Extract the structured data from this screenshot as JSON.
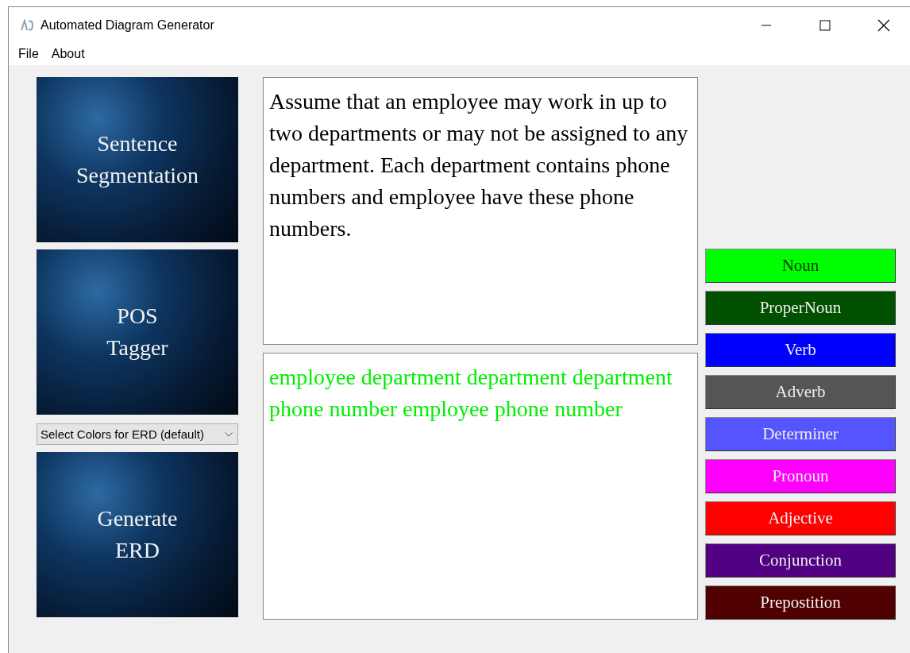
{
  "window": {
    "title": "Automated Diagram Generator"
  },
  "menu": [
    "File",
    "About"
  ],
  "tiles_top": [
    {
      "label": "Sentence Segmentation"
    },
    {
      "label": "POS Tagger"
    }
  ],
  "color_select": {
    "value": "Select Colors for ERD (default)"
  },
  "tiles_bottom": [
    {
      "label": "Generate ERD"
    }
  ],
  "input_text": "Assume that an employee may work in up to two departments or may not be assigned to any department. Each department contains phone numbers and employee have these phone numbers.",
  "output_text": "employee department department department phone number employee phone number",
  "legend": [
    {
      "label": "Noun",
      "color": "#00ff00"
    },
    {
      "label": "ProperNoun",
      "color": "#005000"
    },
    {
      "label": "Verb",
      "color": "#0000ff"
    },
    {
      "label": "Adverb",
      "color": "#555555"
    },
    {
      "label": "Determiner",
      "color": "#5555ff"
    },
    {
      "label": "Pronoun",
      "color": "#ff00ff"
    },
    {
      "label": "Adjective",
      "color": "#ff0000"
    },
    {
      "label": "Conjunction",
      "color": "#500080"
    },
    {
      "label": "Prepostition",
      "color": "#500000"
    }
  ]
}
